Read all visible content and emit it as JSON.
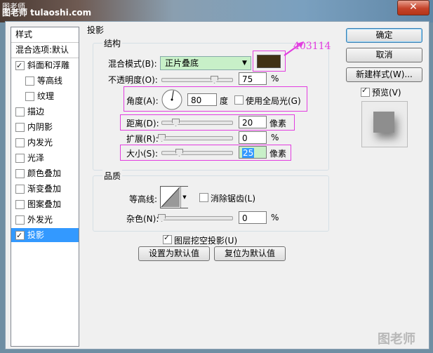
{
  "titlebar": {
    "title": "图老师",
    "watermark": "图老师 tulaoshi.com",
    "close_label": "✕"
  },
  "styles_list": {
    "header": "样式",
    "blend_options": "混合选项:默认",
    "items": [
      {
        "label": "斜面和浮雕",
        "checked": true,
        "indent": false
      },
      {
        "label": "等高线",
        "checked": false,
        "indent": true
      },
      {
        "label": "纹理",
        "checked": false,
        "indent": true
      },
      {
        "label": "描边",
        "checked": false,
        "indent": false
      },
      {
        "label": "内阴影",
        "checked": false,
        "indent": false
      },
      {
        "label": "内发光",
        "checked": false,
        "indent": false
      },
      {
        "label": "光泽",
        "checked": false,
        "indent": false
      },
      {
        "label": "颜色叠加",
        "checked": false,
        "indent": false
      },
      {
        "label": "渐变叠加",
        "checked": false,
        "indent": false
      },
      {
        "label": "图案叠加",
        "checked": false,
        "indent": false
      },
      {
        "label": "外发光",
        "checked": false,
        "indent": false
      },
      {
        "label": "投影",
        "checked": true,
        "indent": false,
        "selected": true
      }
    ]
  },
  "drop_shadow": {
    "title": "投影",
    "structure": {
      "title": "结构",
      "blend_mode_label": "混合模式(B):",
      "blend_mode_value": "正片叠底",
      "shadow_color": "#403114",
      "color_annotation": "403114",
      "opacity_label": "不透明度(O):",
      "opacity_value": "75",
      "opacity_unit": "%",
      "angle_label": "角度(A):",
      "angle_value": "80",
      "angle_unit": "度",
      "global_light_label": "使用全局光(G)",
      "global_light_checked": false,
      "distance_label": "距离(D):",
      "distance_value": "20",
      "distance_unit": "像素",
      "spread_label": "扩展(R):",
      "spread_value": "0",
      "spread_unit": "%",
      "size_label": "大小(S):",
      "size_value": "25",
      "size_unit": "像素"
    },
    "quality": {
      "title": "品质",
      "contour_label": "等高线:",
      "anti_alias_label": "消除锯齿(L)",
      "anti_alias_checked": false,
      "noise_label": "杂色(N):",
      "noise_value": "0",
      "noise_unit": "%"
    },
    "knockout_label": "图层挖空投影(U)",
    "knockout_checked": true,
    "make_default": "设置为默认值",
    "reset_default": "复位为默认值"
  },
  "right_panel": {
    "ok": "确定",
    "cancel": "取消",
    "new_style": "新建样式(W)...",
    "preview_label": "预览(V)",
    "preview_checked": true
  },
  "watermark_bottom": "图老师",
  "colors": {
    "accent_pink": "#e23de0",
    "selection": "#3399ff",
    "shadow": "#403114"
  }
}
